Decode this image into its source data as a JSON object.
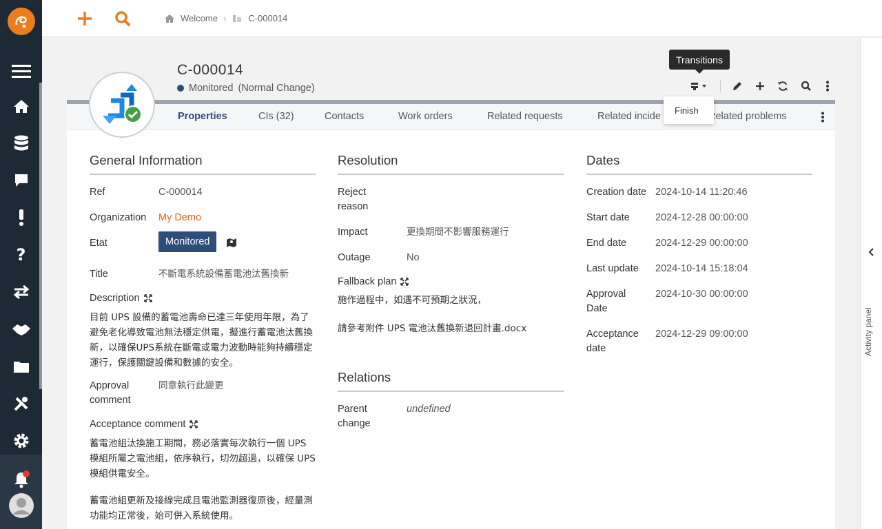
{
  "topbar": {
    "breadcrumb": [
      "Welcome",
      "C-000014"
    ]
  },
  "object": {
    "ref": "C-000014",
    "status": "Monitored",
    "status_detail": "(Normal Change)"
  },
  "toolbar": {
    "tooltip": "Transitions",
    "dropdown_item": "Finish"
  },
  "tabs": [
    "Properties",
    "CIs (32)",
    "Contacts",
    "Work orders",
    "Related requests",
    "Related incide",
    "Related problems"
  ],
  "general": {
    "heading": "General Information",
    "ref_label": "Ref",
    "ref_value": "C-000014",
    "org_label": "Organization",
    "org_value": "My Demo",
    "etat_label": "Etat",
    "etat_value": "Monitored",
    "title_label": "Title",
    "title_value": "不斷電系統設備蓄電池汰舊換新",
    "description_label": "Description",
    "description_text": "目前 UPS 設備的蓄電池壽命已達三年使用年限，為了避免老化導致電池無法穩定供電，擬進行蓄電池汰舊換新，以確保UPS系統在斷電或電力波動時能夠持續穩定運行，保護關鍵設備和數據的安全。",
    "approval_label_1": "Approval",
    "approval_label_2": "comment",
    "approval_value": "同意執行此變更",
    "acceptance_label": "Acceptance comment",
    "acceptance_text_1": "蓄電池組汰換施工期間，務必落實每次執行一個 UPS 模組所屬之電池組，依序執行，切勿超過，以確保 UPS 模組供電安全。",
    "acceptance_text_2": "蓄電池組更新及接線完成且電池監測器復原後，經量測功能均正常後，始可併入系統使用。"
  },
  "resolution": {
    "heading": "Resolution",
    "reject_label_1": "Reject",
    "reject_label_2": "reason",
    "impact_label": "Impact",
    "impact_value": "更換期間不影響服務運行",
    "outage_label": "Outage",
    "outage_value": "No",
    "fallback_label": "Fallback plan",
    "fallback_text_1": "施作過程中，如遇不可預期之狀況，",
    "fallback_text_2": "請參考附件 UPS 電池汰舊換新退回計畫.docx"
  },
  "relations": {
    "heading": "Relations",
    "parent_label_1": "Parent",
    "parent_label_2": "change",
    "parent_value": "undefined"
  },
  "dates": {
    "heading": "Dates",
    "creation_label": "Creation date",
    "creation_value": "2024-10-14 11:20:46",
    "start_label": "Start date",
    "start_value": "2024-12-28 00:00:00",
    "end_label": "End date",
    "end_value": "2024-12-29 00:00:00",
    "lastupdate_label": "Last update",
    "lastupdate_value": "2024-10-14 15:18:04",
    "approval_label_1": "Approval",
    "approval_label_2": "Date",
    "approval_value": "2024-10-30 00:00:00",
    "acceptance_label_1": "Acceptance",
    "acceptance_label_2": "date",
    "acceptance_value": "2024-12-29 09:00:00"
  },
  "right_panel": {
    "label": "Activity panel"
  },
  "colors": {
    "sidebar": "#1d2a35",
    "accent": "#ea7d1e",
    "primary": "#2d4e7a"
  }
}
